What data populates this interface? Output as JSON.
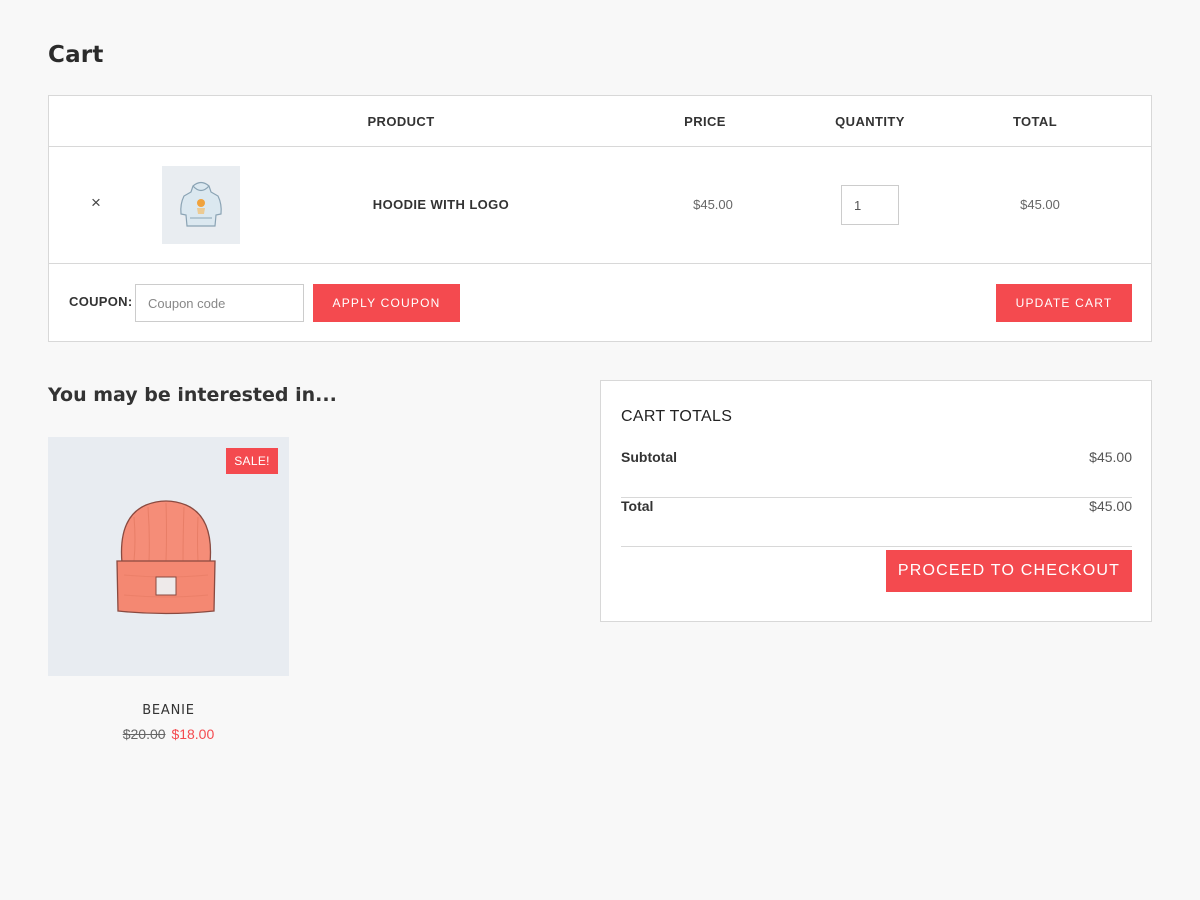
{
  "page": {
    "title": "Cart"
  },
  "cart_table": {
    "headers": {
      "product": "PRODUCT",
      "price": "PRICE",
      "quantity": "QUANTITY",
      "total": "TOTAL"
    },
    "items": [
      {
        "remove_symbol": "×",
        "thumbnail_icon": "hoodie-icon",
        "name": "HOODIE WITH LOGO",
        "price": "$45.00",
        "quantity": "1",
        "total": "$45.00"
      }
    ],
    "coupon": {
      "label": "COUPON:",
      "placeholder": "Coupon code",
      "apply_label": "APPLY COUPON"
    },
    "update_label": "UPDATE CART"
  },
  "cross_sells": {
    "title": "You may be interested in...",
    "products": [
      {
        "name": "BEANIE",
        "sale_badge": "SALE!",
        "old_price": "$20.00",
        "new_price": "$18.00",
        "image_icon": "beanie-icon"
      }
    ]
  },
  "cart_totals": {
    "title": "CART TOTALS",
    "subtotal_label": "Subtotal",
    "subtotal_value": "$45.00",
    "total_label": "Total",
    "total_value": "$45.00",
    "checkout_label": "PROCEED TO CHECKOUT"
  },
  "colors": {
    "accent": "#f44a4f",
    "background": "#f8f8f8",
    "card": "#ffffff",
    "border": "#d8d8d8"
  }
}
